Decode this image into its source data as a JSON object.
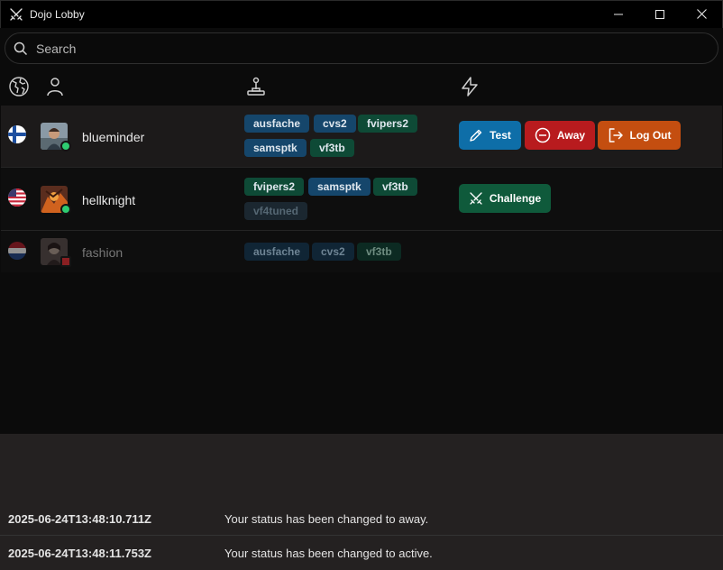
{
  "window": {
    "title": "Dojo Lobby",
    "controls": [
      "minimize-icon",
      "maximize-icon",
      "close-icon"
    ]
  },
  "search": {
    "placeholder": "Search",
    "value": ""
  },
  "columns": {
    "region_icon": "globe-icon",
    "user_icon": "person-icon",
    "games_icon": "joystick-icon",
    "actions_icon": "lightning-icon"
  },
  "players": [
    {
      "flag": "Finland",
      "name": "blueminder",
      "status": "online",
      "tags": [
        {
          "label": "ausfache",
          "color": "blue"
        },
        {
          "label": "cvs2",
          "color": "blue"
        },
        {
          "label": "fvipers2",
          "color": "green"
        },
        {
          "label": "samsptk",
          "color": "blue"
        },
        {
          "label": "vf3tb",
          "color": "green"
        }
      ],
      "actions": [
        {
          "label": "Test",
          "icon": "pencil-icon",
          "color": "#0e6ea8"
        },
        {
          "label": "Away",
          "icon": "minus-circle-icon",
          "color": "#b81b1e"
        },
        {
          "label": "Log Out",
          "icon": "logout-icon",
          "color": "#c44e10"
        }
      ]
    },
    {
      "flag": "United States",
      "name": "hellknight",
      "status": "online",
      "tags": [
        {
          "label": "fvipers2",
          "color": "green"
        },
        {
          "label": "samsptk",
          "color": "blue"
        },
        {
          "label": "vf3tb",
          "color": "green"
        },
        {
          "label": "vf4tuned",
          "color": "grey"
        }
      ],
      "actions": [
        {
          "label": "Challenge",
          "icon": "crossed-swords-icon",
          "color": "#0f5a3b"
        }
      ]
    },
    {
      "flag": "Netherlands",
      "name": "fashion",
      "status": "away",
      "tags": [
        {
          "label": "ausfache",
          "color": "blue"
        },
        {
          "label": "cvs2",
          "color": "blue"
        },
        {
          "label": "vf3tb",
          "color": "green"
        }
      ],
      "actions": []
    }
  ],
  "log": [
    {
      "timestamp": "2025-06-24T13:48:10.711Z",
      "message": "Your status has been changed to away."
    },
    {
      "timestamp": "2025-06-24T13:48:11.753Z",
      "message": "Your status has been changed to active."
    }
  ],
  "colors": {
    "online": "#2ecc71",
    "away": "#c0392b"
  }
}
